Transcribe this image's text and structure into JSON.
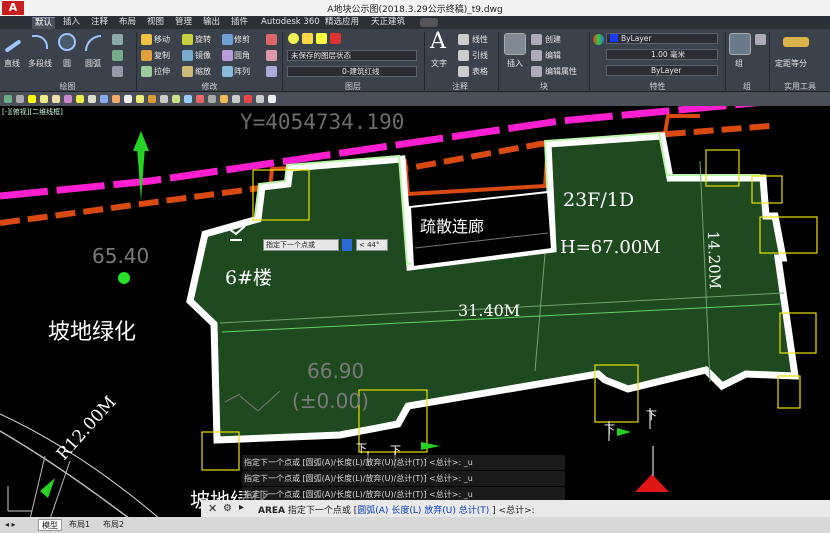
{
  "window": {
    "title": "A地块公示图(2018.3.29公示终稿)_t9.dwg",
    "app_icon": "A"
  },
  "ribbon_tabs": [
    "默认",
    "插入",
    "注释",
    "布局",
    "视图",
    "管理",
    "输出",
    "插件",
    "Autodesk 360",
    "精选应用",
    "天正建筑"
  ],
  "active_tab": "默认",
  "ribbon": {
    "draw": {
      "label": "绘图",
      "line": "直线",
      "polyline": "多段线",
      "circle": "圆",
      "arc": "圆弧"
    },
    "modify": {
      "label": "修改",
      "move": "移动",
      "rotate": "旋转",
      "trim": "修剪",
      "copy": "复制",
      "mirror": "镜像",
      "fillet": "圆角",
      "stretch": "拉伸",
      "scale": "缩放",
      "array": "阵列"
    },
    "layers": {
      "label": "图层",
      "layer_state": "未保存的图层状态",
      "current_layer": "0-建筑红线"
    },
    "annotation": {
      "label": "注释",
      "text": "文字",
      "linear": "线性",
      "leader": "引线",
      "table": "表格"
    },
    "block": {
      "label": "块",
      "insert": "插入",
      "create": "创建",
      "edit": "编辑",
      "edit_attrib": "编辑属性"
    },
    "properties": {
      "label": "特性",
      "color": "ByLayer",
      "lineweight": "1.00 毫米",
      "linetype": "ByLayer"
    },
    "groups": {
      "label": "组",
      "group": "组"
    },
    "utilities": {
      "label": "实用工具",
      "measure": "定距等分"
    }
  },
  "view_label": "[-][俯视][二维线框]",
  "drawing": {
    "coord_text": "Y=4054734.190",
    "building_floors": "23F/1D",
    "building_height": "H=67.00M",
    "corridor": "疏散连廊",
    "building_name": "6#楼",
    "dim_length": "31.40M",
    "dim_width": "14.20M",
    "elev_left": "65.40",
    "elev_bottom": "66.90",
    "elev_zero": "(±0.00)",
    "green_slope": "坡地绿化",
    "radius": "R12.00M",
    "partial_label": "坡地绿化",
    "stair_label": "下"
  },
  "tooltip": {
    "prompt": "指定下一个点或",
    "angle": "< 44°"
  },
  "command_history": [
    "指定下一个点或 [圆弧(A)/长度(L)/放弃(U)/总计(T)] <总计>: _u",
    "指定下一个点或 [圆弧(A)/长度(L)/放弃(U)/总计(T)] <总计>: _u",
    "指定下一个点或 [圆弧(A)/长度(L)/放弃(U)/总计(T)] <总计>: _u"
  ],
  "command_line": {
    "command": "AREA",
    "prompt": "指定下一个点或 [",
    "opt_arc": "圆弧(A)",
    "opt_length": "长度(L)",
    "opt_undo": "放弃(U)",
    "opt_total": "总计(T)",
    "suffix": "] <总计>:"
  },
  "status_tabs": [
    "模型",
    "布局1",
    "布局2"
  ],
  "active_status_tab": "模型",
  "colors": {
    "building_fill": "#1f4a1f",
    "outline": "#ffffff",
    "red_line": "#d84a12",
    "magenta_line": "#ff1fd0",
    "highlight_box": "#e8e000",
    "dim_line": "#3ad23a"
  }
}
